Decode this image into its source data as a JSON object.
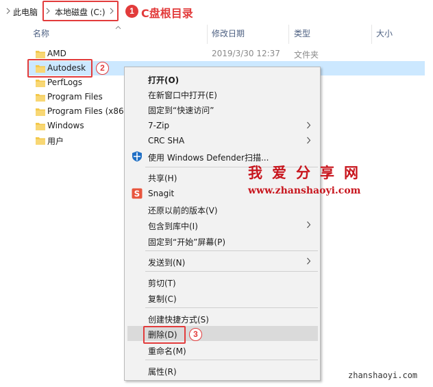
{
  "address_bar": {
    "crumbs": [
      "此电脑",
      "本地磁盘 (C:)"
    ]
  },
  "annotations": {
    "step1_number": "1",
    "step1_text": "C盘根目录",
    "step2_number": "2",
    "step3_number": "3"
  },
  "columns": {
    "name": "名称",
    "date": "修改日期",
    "type": "类型",
    "size": "大小"
  },
  "files": [
    {
      "name": "AMD",
      "date": "2019/3/30 12:37",
      "type": "文件夹"
    },
    {
      "name": "Autodesk",
      "date": "",
      "type": "",
      "selected": true
    },
    {
      "name": "PerfLogs",
      "date": "",
      "type": ""
    },
    {
      "name": "Program Files",
      "date": "",
      "type": ""
    },
    {
      "name": "Program Files (x86)",
      "date": "",
      "type": ""
    },
    {
      "name": "Windows",
      "date": "",
      "type": ""
    },
    {
      "name": "用户",
      "date": "",
      "type": ""
    }
  ],
  "context_menu": {
    "open": "打开(O)",
    "open_new_window": "在新窗口中打开(E)",
    "pin_quick_access": "固定到“快速访问”",
    "seven_zip": "7-Zip",
    "crc_sha": "CRC SHA",
    "defender": "使用 Windows Defender扫描...",
    "share": "共享(H)",
    "snagit": "Snagit",
    "restore_previous": "还原以前的版本(V)",
    "include_in_library": "包含到库中(I)",
    "pin_start": "固定到“开始”屏幕(P)",
    "send_to": "发送到(N)",
    "cut": "剪切(T)",
    "copy": "复制(C)",
    "create_shortcut": "创建快捷方式(S)",
    "delete": "删除(D)",
    "rename": "重命名(M)",
    "properties": "属性(R)"
  },
  "watermark": {
    "title": "我爱分享网",
    "url": "www.zhanshaoyi.com",
    "footer": "zhanshaoyi.com"
  },
  "colors": {
    "accent_red": "#e23b3b",
    "selection": "#cce8ff",
    "menu_bg": "#f2f2f2",
    "watermark_red": "#c8161e",
    "folder": "#f3c84b"
  },
  "icons": [
    "chevron-right-icon",
    "folder-icon",
    "shield-icon",
    "snagit-icon",
    "sort-up-icon"
  ]
}
